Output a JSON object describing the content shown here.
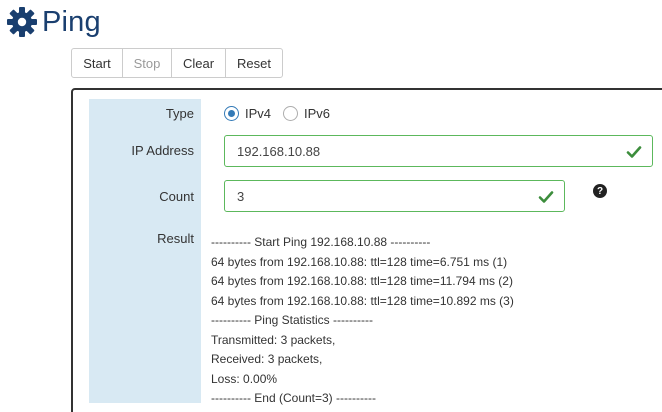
{
  "page": {
    "title": "Ping",
    "title_icon": "gear-icon",
    "title_color": "#1a3f6f"
  },
  "toolbar": {
    "start_label": "Start",
    "stop_label": "Stop",
    "clear_label": "Clear",
    "reset_label": "Reset"
  },
  "form": {
    "type_label": "Type",
    "type_options": [
      {
        "label": "IPv4",
        "selected": true
      },
      {
        "label": "IPv6",
        "selected": false
      }
    ],
    "ip_label": "IP Address",
    "ip_value": "192.168.10.88",
    "count_label": "Count",
    "count_value": "3",
    "help_icon": "question-circle-icon",
    "result_label": "Result",
    "result_lines": [
      "---------- Start Ping 192.168.10.88 ----------",
      "64 bytes from 192.168.10.88: ttl=128 time=6.751 ms (1)",
      "64 bytes from 192.168.10.88: ttl=128 time=11.794 ms (2)",
      "64 bytes from 192.168.10.88: ttl=128 time=10.892 ms (3)",
      "---------- Ping Statistics ----------",
      "Transmitted: 3 packets,",
      "Received: 3 packets,",
      "Loss: 0.00%",
      "---------- End (Count=3) ----------"
    ]
  },
  "colors": {
    "label_column_bg": "#d8e9f3",
    "valid_border": "#5cb85c",
    "checkmark": "#3c8d3c",
    "radio_selected": "#337ab7"
  }
}
